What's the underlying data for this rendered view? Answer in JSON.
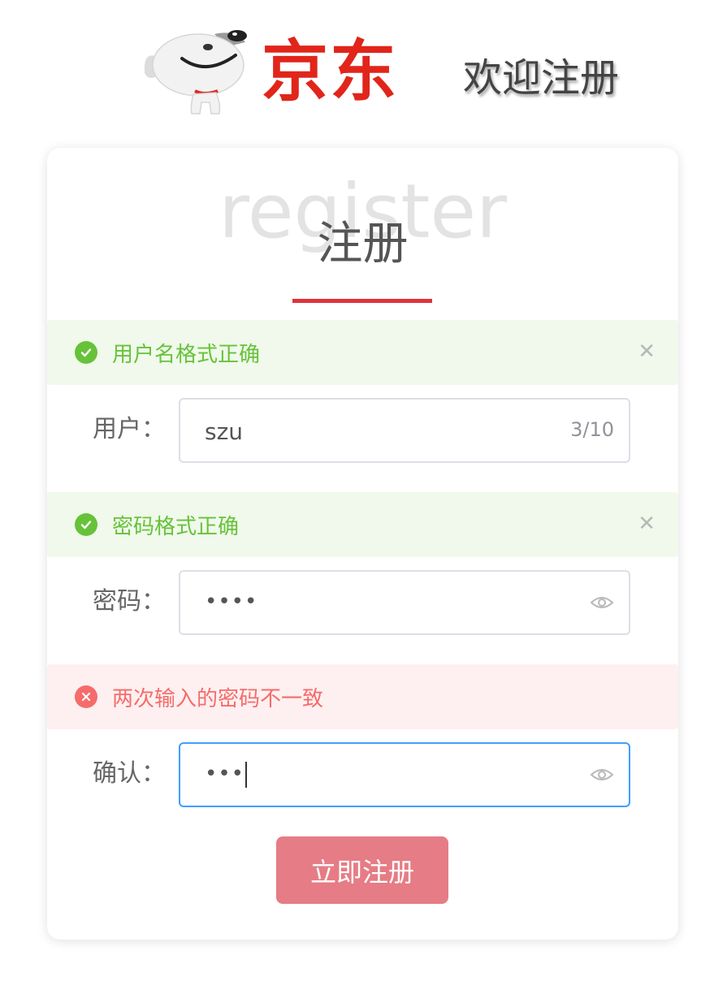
{
  "header": {
    "brand": "京东",
    "welcome": "欢迎注册",
    "logo_icon": "jd-dog-mascot-icon",
    "colors": {
      "brand_red": "#e1251b"
    }
  },
  "card": {
    "bg_word": "register",
    "title": "注册",
    "accent_color": "#e0323a"
  },
  "alerts": {
    "username": {
      "type": "success",
      "message": "用户名格式正确",
      "icon": "check-circle-icon",
      "closable": true
    },
    "password": {
      "type": "success",
      "message": "密码格式正确",
      "icon": "check-circle-icon",
      "closable": true
    },
    "confirm": {
      "type": "error",
      "message": "两次输入的密码不一致",
      "icon": "error-circle-icon",
      "closable": false
    }
  },
  "form": {
    "username": {
      "label": "用户：",
      "value": "szu",
      "counter": "3/10"
    },
    "password": {
      "label": "密码：",
      "masked_value": "••••",
      "toggle_icon": "eye-icon"
    },
    "confirm": {
      "label": "确认：",
      "masked_value": "•••",
      "toggle_icon": "eye-icon",
      "focused": true
    }
  },
  "submit": {
    "label": "立即注册",
    "color": "#e67c85"
  },
  "colors": {
    "success": "#67c23a",
    "error": "#f56c6c",
    "focus": "#409eff"
  }
}
